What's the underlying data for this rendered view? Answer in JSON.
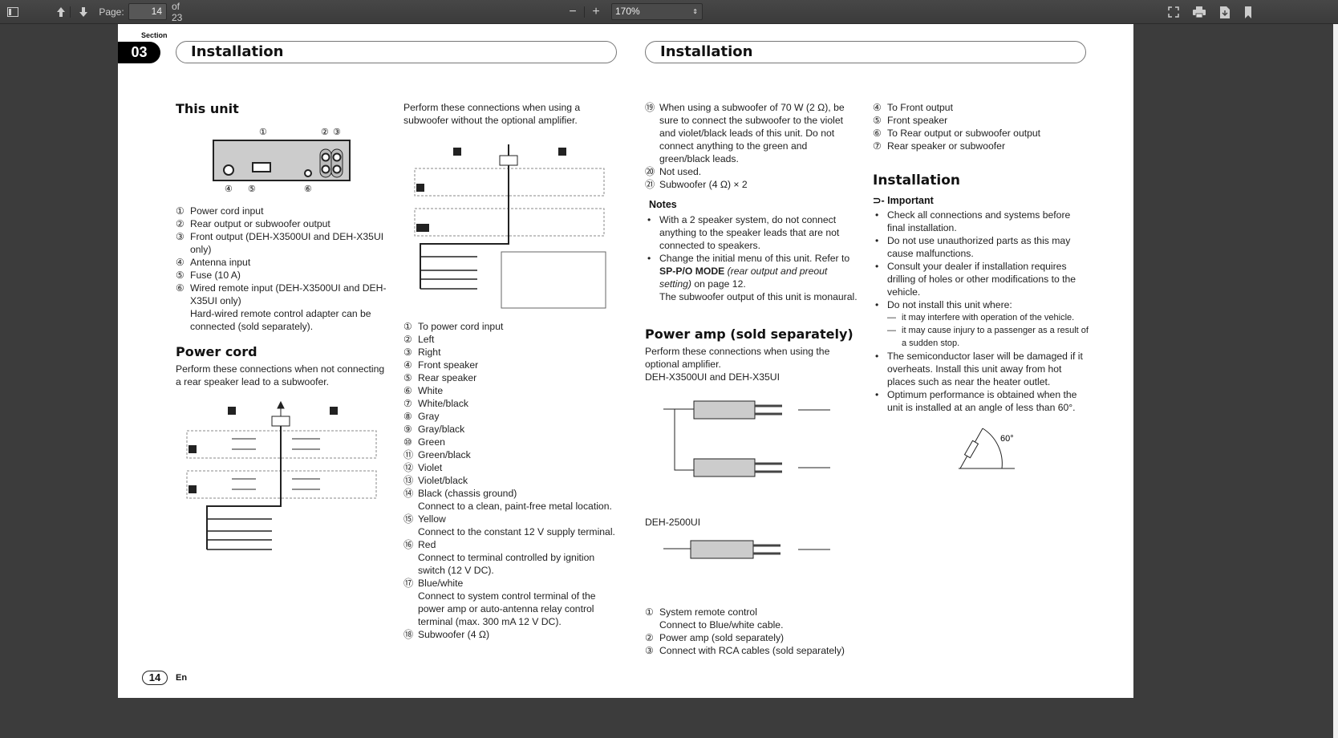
{
  "toolbar": {
    "page_label": "Page:",
    "page_value": "14",
    "page_total": "of 23",
    "zoom_value": "170%",
    "icons": [
      "sidebar-toggle-icon",
      "previous-page-icon",
      "next-page-icon",
      "zoom-out-icon",
      "zoom-in-icon",
      "fullscreen-icon",
      "print-icon",
      "download-icon",
      "bookmark-icon"
    ],
    "minus": "−",
    "plus": "+"
  },
  "page": {
    "section_label": "Section",
    "section_number": "03",
    "header_left": "Installation",
    "header_right": "Installation",
    "footer_page": "14",
    "footer_lang": "En",
    "col1": {
      "title": "This unit",
      "diagram_labels": [
        "①",
        "②",
        "③",
        "④",
        "⑤",
        "⑥"
      ],
      "items": [
        {
          "n": "①",
          "t": "Power cord input"
        },
        {
          "n": "②",
          "t": "Rear output or subwoofer output"
        },
        {
          "n": "③",
          "t": "Front output (DEH-X3500UI and DEH-X35UI only)"
        },
        {
          "n": "④",
          "t": "Antenna input"
        },
        {
          "n": "⑤",
          "t": "Fuse (10 A)"
        },
        {
          "n": "⑥",
          "t": "Wired remote input (DEH-X3500UI and DEH-X35UI only)\nHard-wired remote control adapter can be connected (sold separately)."
        }
      ],
      "power_title": "Power cord",
      "power_text": "Perform these connections when not connecting a rear speaker lead to a subwoofer."
    },
    "col2": {
      "intro": "Perform these connections when using a subwoofer without the optional amplifier.",
      "items": [
        {
          "n": "①",
          "t": "To power cord input"
        },
        {
          "n": "②",
          "t": "Left"
        },
        {
          "n": "③",
          "t": "Right"
        },
        {
          "n": "④",
          "t": "Front speaker"
        },
        {
          "n": "⑤",
          "t": "Rear speaker"
        },
        {
          "n": "⑥",
          "t": "White"
        },
        {
          "n": "⑦",
          "t": "White/black"
        },
        {
          "n": "⑧",
          "t": "Gray"
        },
        {
          "n": "⑨",
          "t": "Gray/black"
        },
        {
          "n": "⑩",
          "t": "Green"
        },
        {
          "n": "⑪",
          "t": "Green/black"
        },
        {
          "n": "⑫",
          "t": "Violet"
        },
        {
          "n": "⑬",
          "t": "Violet/black"
        },
        {
          "n": "⑭",
          "t": "Black (chassis ground)\nConnect to a clean, paint-free metal location."
        },
        {
          "n": "⑮",
          "t": "Yellow\nConnect to the constant 12 V supply terminal."
        },
        {
          "n": "⑯",
          "t": "Red\nConnect to terminal controlled by ignition switch (12 V DC)."
        },
        {
          "n": "⑰",
          "t": "Blue/white\nConnect to system control terminal of the power amp or auto-antenna relay control terminal (max. 300 mA 12 V DC)."
        },
        {
          "n": "⑱",
          "t": "Subwoofer (4 Ω)"
        }
      ]
    },
    "col3": {
      "items": [
        {
          "n": "⑲",
          "t": "When using a subwoofer of 70 W (2 Ω), be sure to connect the subwoofer to the violet and violet/black leads of this unit. Do not connect anything to the green and green/black leads."
        },
        {
          "n": "⑳",
          "t": "Not used."
        },
        {
          "n": "㉑",
          "t": "Subwoofer (4 Ω) × 2"
        }
      ],
      "notes_title": "Notes",
      "notes": [
        "With a 2 speaker system, do not connect anything to the speaker leads that are not connected to speakers.",
        "Change the initial menu of this unit. Refer to"
      ],
      "note2_bold": "SP-P/O MODE",
      "note2_italic": "(rear output and preout setting)",
      "note2_tail": " on page 12.",
      "note2_extra": "The subwoofer output of this unit is monaural.",
      "amp_title": "Power amp (sold separately)",
      "amp_text": "Perform these connections when using the optional amplifier.",
      "amp_model1": "DEH-X3500UI and DEH-X35UI",
      "amp_model2": "DEH-2500UI",
      "amp_items": [
        {
          "n": "①",
          "t": "System remote control\nConnect to Blue/white cable."
        },
        {
          "n": "②",
          "t": "Power amp (sold separately)"
        },
        {
          "n": "③",
          "t": "Connect with RCA cables (sold separately)"
        }
      ]
    },
    "col4": {
      "items": [
        {
          "n": "④",
          "t": "To Front output"
        },
        {
          "n": "⑤",
          "t": "Front speaker"
        },
        {
          "n": "⑥",
          "t": "To Rear output or subwoofer output"
        },
        {
          "n": "⑦",
          "t": "Rear speaker or subwoofer"
        }
      ],
      "install_title": "Installation",
      "important_label": "Important",
      "bullets": [
        "Check all connections and systems before final installation.",
        "Do not use unauthorized parts as this may cause malfunctions.",
        "Consult your dealer if installation requires drilling of holes or other modifications to the vehicle.",
        "Do not install this unit where:"
      ],
      "dashes": [
        "it may interfere with operation of the vehicle.",
        "it may cause injury to a passenger as a result of a sudden stop."
      ],
      "bullets2": [
        "The semiconductor laser will be damaged if it overheats. Install this unit away from hot places such as near the heater outlet.",
        "Optimum performance is obtained when the unit is installed at an angle of less than 60°."
      ],
      "angle_label": "60°"
    }
  }
}
